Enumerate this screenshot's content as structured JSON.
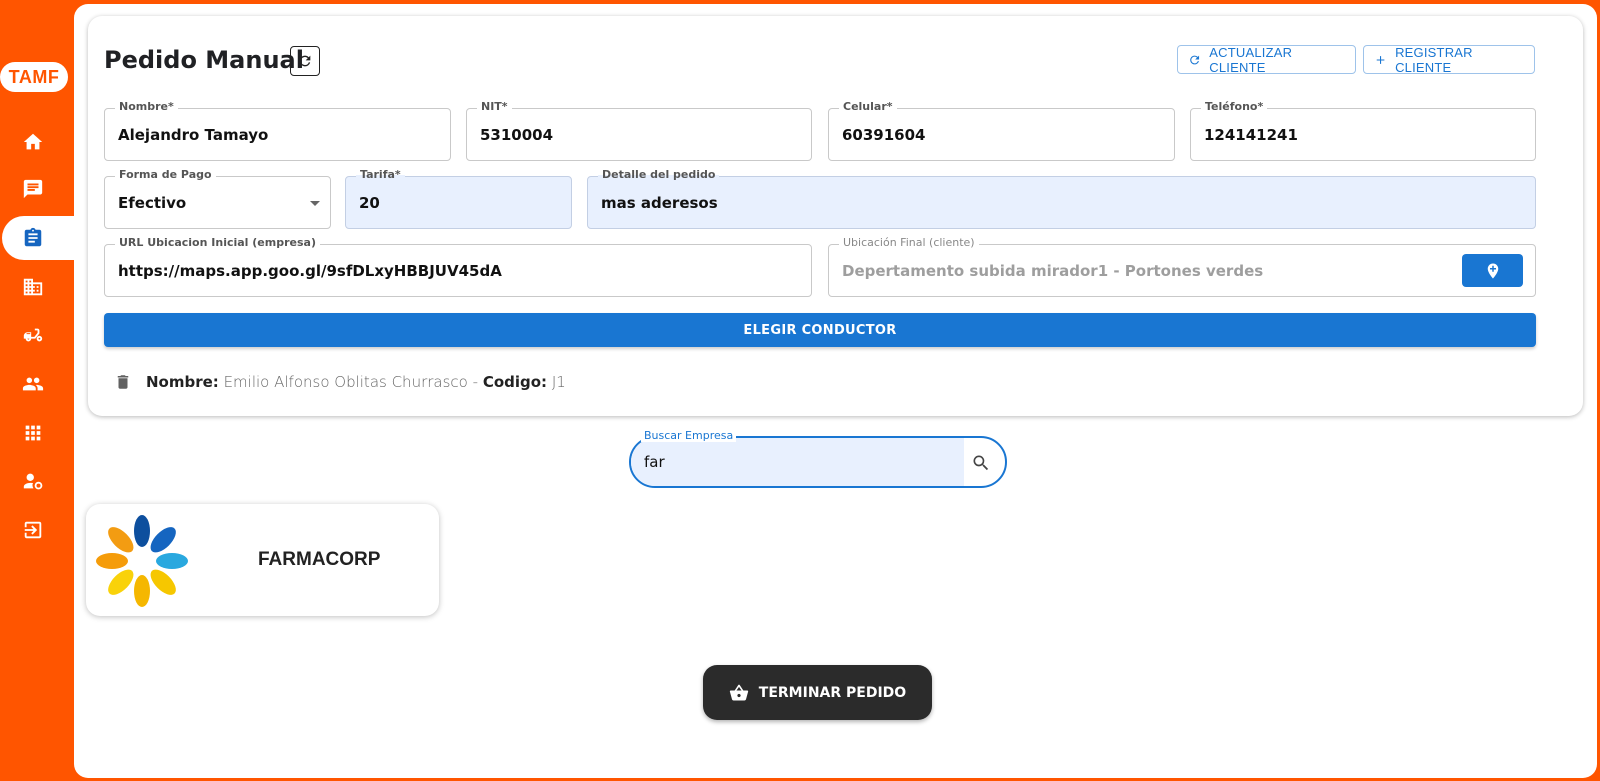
{
  "app": {
    "logo_text": "TAMF"
  },
  "sidebar": {
    "items": [
      {
        "icon": "home-icon"
      },
      {
        "icon": "chat-icon"
      },
      {
        "icon": "clipboard-icon",
        "active": true
      },
      {
        "icon": "building-icon"
      },
      {
        "icon": "scooter-icon"
      },
      {
        "icon": "people-icon"
      },
      {
        "icon": "grid-icon"
      },
      {
        "icon": "user-settings-icon"
      },
      {
        "icon": "logout-icon"
      }
    ]
  },
  "header": {
    "title": "Pedido Manual",
    "update_client_label": "ACTUALIZAR CLIENTE",
    "register_client_label": "REGISTRAR CLIENTE"
  },
  "form": {
    "nombre": {
      "label": "Nombre*",
      "value": "Alejandro Tamayo"
    },
    "nit": {
      "label": "NIT*",
      "value": "5310004"
    },
    "celular": {
      "label": "Celular*",
      "value": "60391604"
    },
    "telefono": {
      "label": "Teléfono*",
      "value": "124141241"
    },
    "forma_pago": {
      "label": "Forma de Pago",
      "value": "Efectivo"
    },
    "tarifa": {
      "label": "Tarifa*",
      "value": "20"
    },
    "detalle": {
      "label": "Detalle del pedido",
      "value": "mas aderesos"
    },
    "url_ubicacion": {
      "label": "URL Ubicacion Inicial (empresa)",
      "value": "https://maps.app.goo.gl/9sfDLxyHBBJUV45dA"
    },
    "ubicacion_final": {
      "label": "Ubicación Final (cliente)",
      "value": "Depertamento subida mirador1 - Portones verdes"
    }
  },
  "choose_driver_label": "ELEGIR CONDUCTOR",
  "driver": {
    "name_label": "Nombre:",
    "name_value": "Emilio Alfonso Oblitas Churrasco -",
    "code_label": "Codigo:",
    "code_value": "J1"
  },
  "search": {
    "label": "Buscar Empresa",
    "value": "far"
  },
  "companies": [
    {
      "name": "FARMACORP"
    }
  ],
  "finish_label": "TERMINAR PEDIDO",
  "colors": {
    "brand": "#ff5500",
    "primary": "#1976d2",
    "dark": "#2b2b2b"
  }
}
